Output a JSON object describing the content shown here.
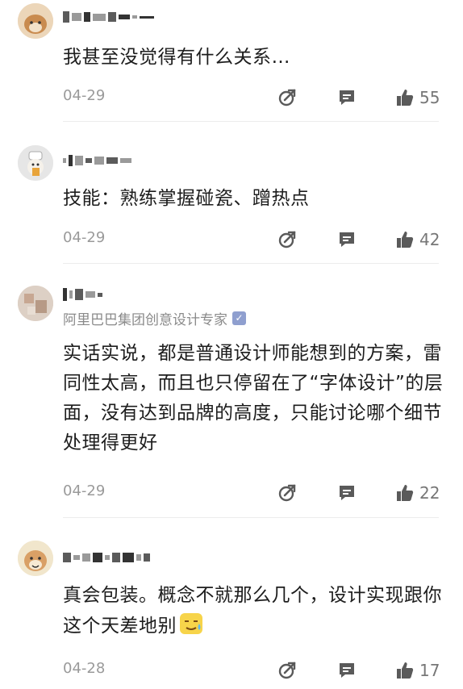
{
  "comments": [
    {
      "text": "我甚至没觉得有什么关系…",
      "date": "04-29",
      "likes": "55",
      "avatar_icon": "shiba-dog-avatar-icon"
    },
    {
      "text": "技能：熟练掌握碰瓷、蹭热点",
      "date": "04-29",
      "likes": "42",
      "avatar_icon": "cartoon-chef-avatar-icon"
    },
    {
      "org": "阿里巴巴集团创意设计专家",
      "text": "实话实说，都是普通设计师能想到的方案，雷同性太高，而且也只停留在了“字体设计”的层面，没有达到品牌的高度，只能讨论哪个细节处理得更好",
      "date": "04-29",
      "likes": "22",
      "avatar_icon": "blurred-photo-avatar-icon"
    },
    {
      "text": "真会包装。概念不就那么几个，设计实现跟你这个天差地别",
      "date": "04-28",
      "likes": "17",
      "avatar_icon": "smiling-dog-avatar-icon"
    }
  ],
  "icons": {
    "share": "share-icon",
    "reply": "reply-icon",
    "like": "thumbs-up-icon",
    "verified": "verified-badge-icon",
    "emoji": "sweat-smile-emoji-icon"
  },
  "colors": {
    "icon": "#5a5a5a",
    "meta": "#9a9a9a",
    "text": "#1d1d1d",
    "verified": "#8f9fcf"
  }
}
